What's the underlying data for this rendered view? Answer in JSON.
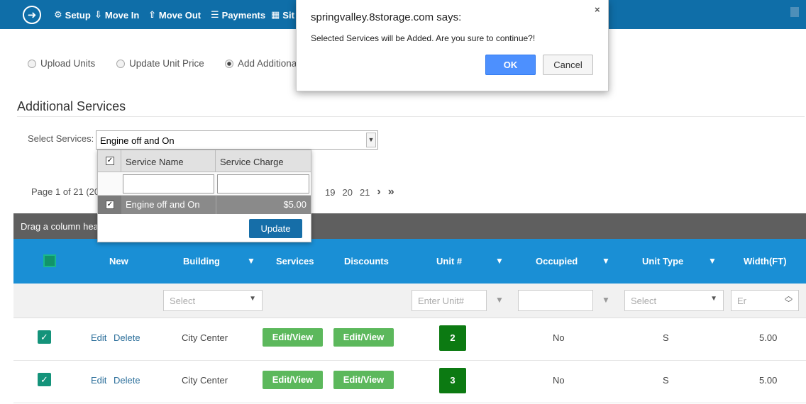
{
  "nav": {
    "items": [
      {
        "icon": "gear-icon",
        "glyph": "⚙",
        "label": "Setup"
      },
      {
        "icon": "move-in-icon",
        "glyph": "⇩",
        "label": "Move In"
      },
      {
        "icon": "move-out-icon",
        "glyph": "⇧",
        "label": "Move Out"
      },
      {
        "icon": "database-icon",
        "glyph": "☰",
        "label": "Payments"
      },
      {
        "icon": "grid-icon",
        "glyph": "▦",
        "label": "Sit"
      }
    ]
  },
  "modes": {
    "upload": "Upload Units",
    "update_price": "Update Unit Price",
    "add_services": "Add Additiona"
  },
  "section": {
    "title": "Additional Services",
    "select_label": "Select Services:",
    "select_value": "Engine off and On"
  },
  "pager": {
    "info": "Page 1 of 21 (20",
    "pages": [
      "19",
      "20",
      "21"
    ],
    "next": "›",
    "last": "»"
  },
  "dropdown": {
    "col_name": "Service Name",
    "col_charge": "Service Charge",
    "row": {
      "name": "Engine off and On",
      "charge": "$5.00"
    },
    "update_label": "Update"
  },
  "grid": {
    "group_hint": "Drag a column hea",
    "headers": {
      "new": "New",
      "building": "Building",
      "services": "Services",
      "discounts": "Discounts",
      "unit": "Unit #",
      "occupied": "Occupied",
      "unit_type": "Unit Type",
      "width": "Width(FT)"
    },
    "filters": {
      "building": "Select",
      "unit": "Enter Unit#",
      "unit_type": "Select",
      "width": "Er"
    },
    "rows": [
      {
        "edit": "Edit",
        "delete": "Delete",
        "building": "City Center",
        "services": "Edit/View",
        "discounts": "Edit/View",
        "unit": "2",
        "occupied": "No",
        "unit_type": "S",
        "width": "5.00"
      },
      {
        "edit": "Edit",
        "delete": "Delete",
        "building": "City Center",
        "services": "Edit/View",
        "discounts": "Edit/View",
        "unit": "3",
        "occupied": "No",
        "unit_type": "S",
        "width": "5.00"
      }
    ]
  },
  "dialog": {
    "title": "springvalley.8storage.com says:",
    "message": "Selected Services will be Added. Are you sure to continue?!",
    "ok": "OK",
    "cancel": "Cancel",
    "close": "×"
  },
  "colors": {
    "nav": "#0f6ea8",
    "grid_header": "#1a8fd5",
    "green_button": "#5cb85c",
    "unit_badge": "#0c7a12",
    "dialog_ok": "#4d90fe"
  }
}
